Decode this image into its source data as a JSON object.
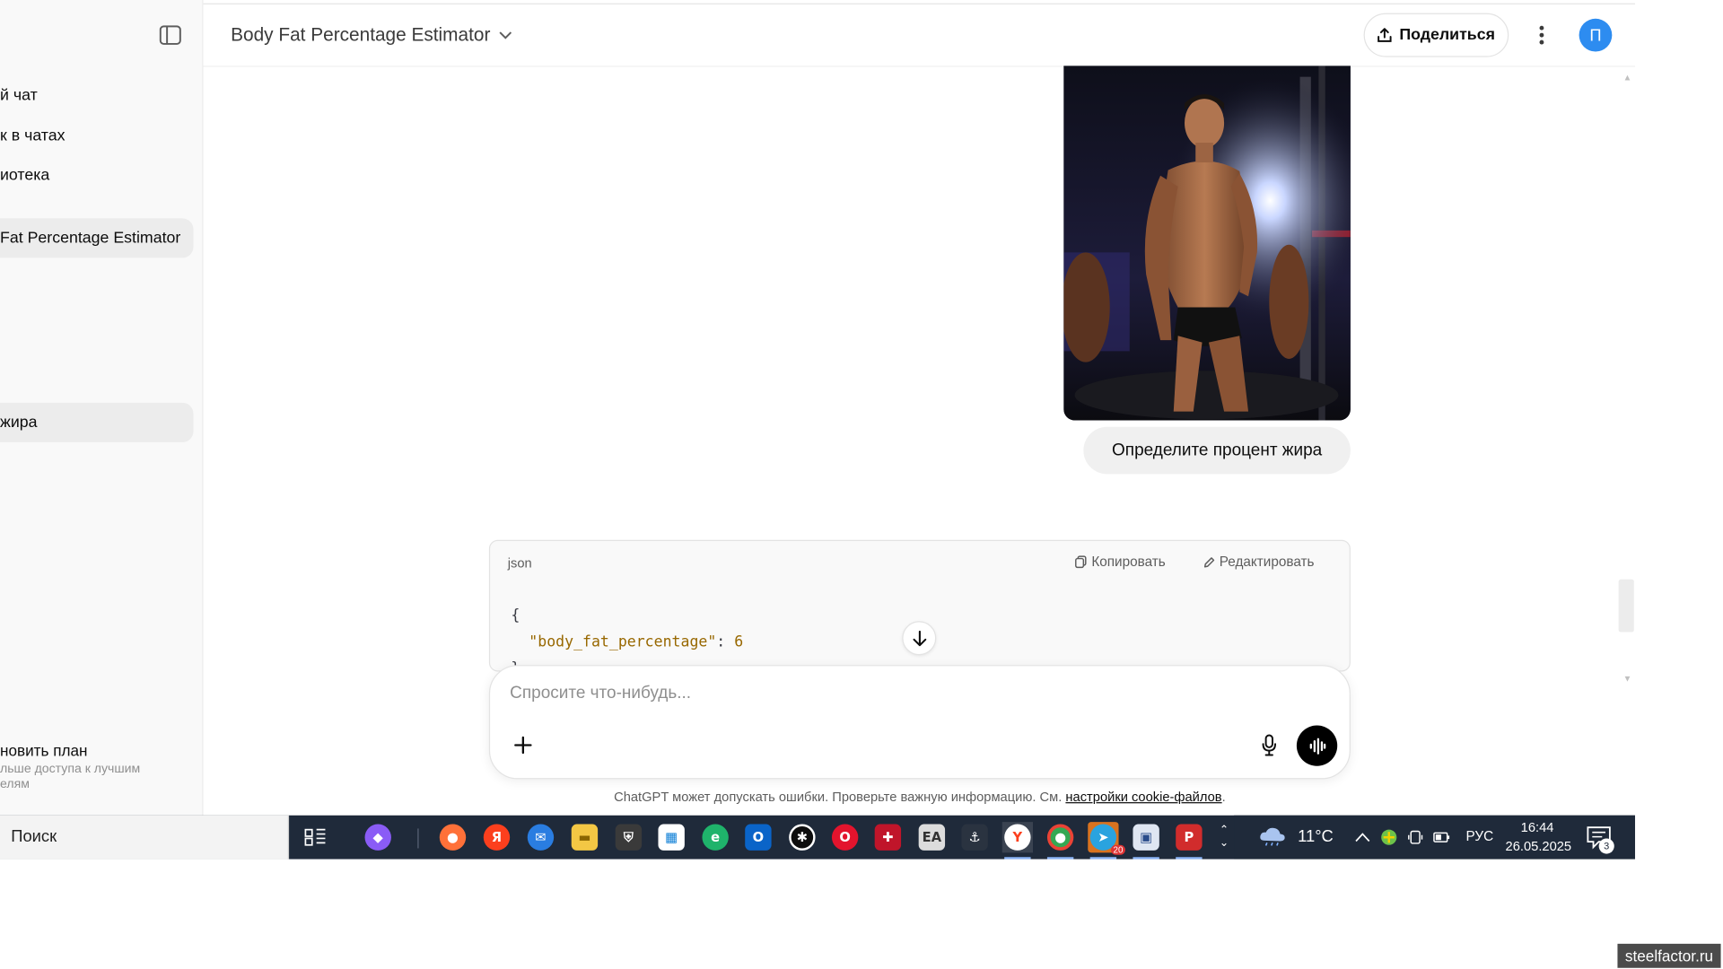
{
  "sidebar": {
    "items": [
      {
        "label": "й чат"
      },
      {
        "label": "к в чатах"
      },
      {
        "label": "иотека"
      },
      {
        "label": "Fat Percentage Estimator"
      },
      {
        "label": "жира"
      }
    ],
    "upgrade_title": "новить план",
    "upgrade_sub_1": "льше доступа к лучшим",
    "upgrade_sub_2": "елям"
  },
  "header": {
    "title": "Body Fat Percentage Estimator",
    "share_label": "Поделиться",
    "avatar_letter": "П"
  },
  "chat": {
    "user_message": "Определите процент жира",
    "code": {
      "language": "json",
      "copy_label": "Копировать",
      "edit_label": "Редактировать",
      "line_open": "{",
      "key": "\"body_fat_percentage\"",
      "colon": ": ",
      "value": "6",
      "line_close": "}"
    }
  },
  "composer": {
    "placeholder": "Спросите что-нибудь..."
  },
  "footer": {
    "disclaimer": "ChatGPT может допускать ошибки. Проверьте важную информацию. См. ",
    "link": "настройки cookie-файлов",
    "end": "."
  },
  "taskbar": {
    "search": "Поиск",
    "telegram_badge": "20",
    "weather": "11°C",
    "lang": "РУС",
    "time": "16:44",
    "date": "26.05.2025",
    "notifications": "3"
  },
  "watermark": "steelfactor.ru",
  "colors": {
    "avatar": "#2d8cf0",
    "taskbar": "#1f2a3a",
    "active_item": "#ececec"
  }
}
